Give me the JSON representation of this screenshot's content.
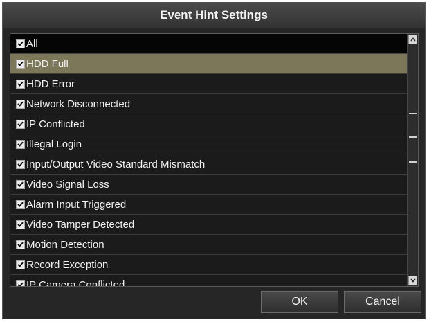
{
  "dialog": {
    "title": "Event Hint Settings",
    "ok_label": "OK",
    "cancel_label": "Cancel"
  },
  "events": [
    {
      "label": "All",
      "checked": true,
      "header": true
    },
    {
      "label": "HDD Full",
      "checked": true,
      "selected": true
    },
    {
      "label": "HDD Error",
      "checked": true
    },
    {
      "label": "Network Disconnected",
      "checked": true
    },
    {
      "label": "IP Conflicted",
      "checked": true
    },
    {
      "label": "Illegal Login",
      "checked": true
    },
    {
      "label": "Input/Output Video Standard Mismatch",
      "checked": true
    },
    {
      "label": "Video Signal Loss",
      "checked": true
    },
    {
      "label": "Alarm Input Triggered",
      "checked": true
    },
    {
      "label": "Video Tamper Detected",
      "checked": true
    },
    {
      "label": "Motion Detection",
      "checked": true
    },
    {
      "label": "Record Exception",
      "checked": true
    },
    {
      "label": "IP Camera Conflicted",
      "checked": true
    }
  ],
  "colors": {
    "selected_row": "#7b7758",
    "background": "#262626"
  }
}
